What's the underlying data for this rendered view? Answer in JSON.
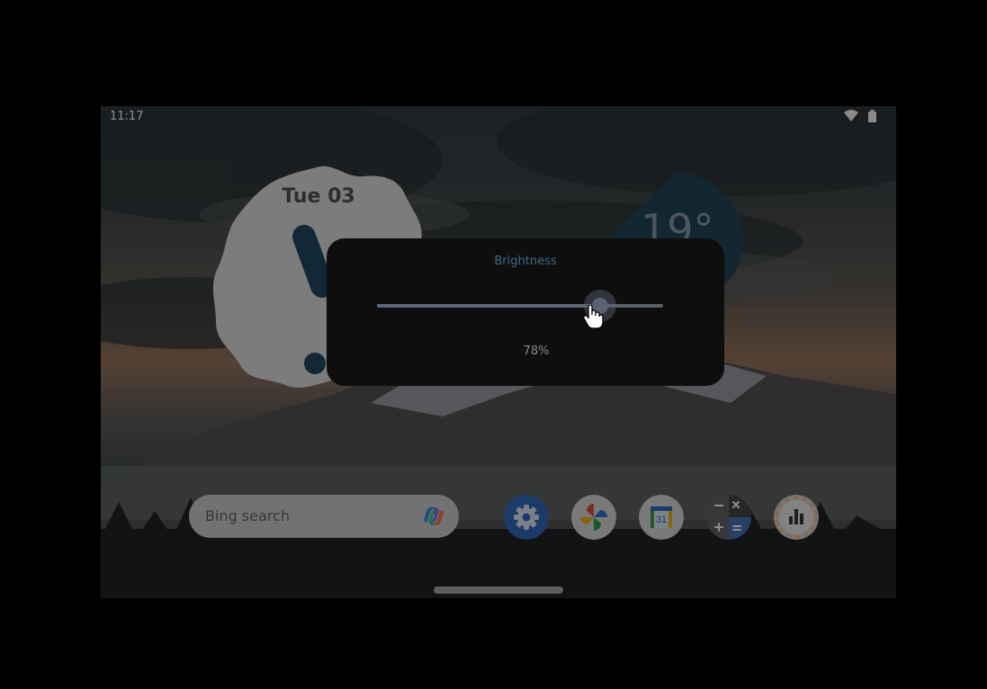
{
  "status_bar": {
    "time": "11:17",
    "wifi_icon": "wifi-icon",
    "battery_icon": "battery-icon"
  },
  "clock_widget": {
    "date": "Tue 03"
  },
  "weather_widget": {
    "temperature": "19°"
  },
  "search_bar": {
    "placeholder": "Bing search",
    "icon": "copilot-icon"
  },
  "dock": {
    "apps": [
      {
        "icon": "settings-icon"
      },
      {
        "icon": "photos-icon"
      },
      {
        "icon": "calendar-icon",
        "label": "31"
      },
      {
        "icon": "calculator-icon"
      },
      {
        "icon": "stats-icon"
      }
    ]
  },
  "brightness_dialog": {
    "title": "Brightness",
    "value_label": "78%",
    "level": 0.78
  },
  "colors": {
    "accent": "#3f6a85",
    "dialog_bg": "#0e0e0e"
  }
}
